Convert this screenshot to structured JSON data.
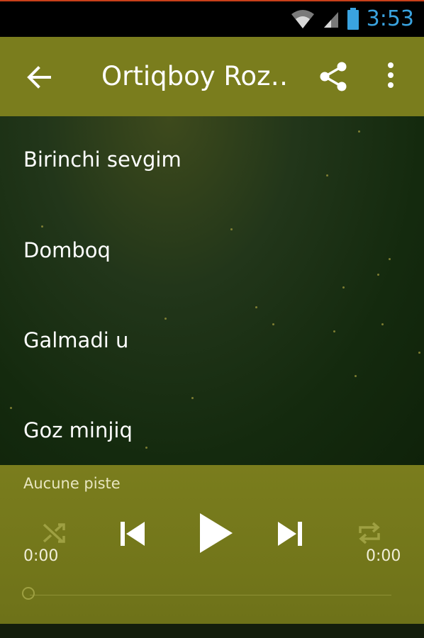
{
  "status_bar": {
    "time": "3:53",
    "icons": [
      "wifi-icon",
      "signal-icon",
      "battery-icon"
    ]
  },
  "app_bar": {
    "title": "Ortiqboy Roz…",
    "back_icon": "arrow-back-icon",
    "share_icon": "share-icon",
    "more_icon": "more-vert-icon"
  },
  "tracks": [
    {
      "label": "Birinchi sevgim"
    },
    {
      "label": "Domboq"
    },
    {
      "label": "Galmadi u"
    },
    {
      "label": "Goz minjiq"
    }
  ],
  "player": {
    "now_playing": "Aucune piste",
    "elapsed": "0:00",
    "duration": "0:00",
    "progress": 0,
    "controls": [
      "shuffle-icon",
      "skip-previous-icon",
      "play-icon",
      "skip-next-icon",
      "repeat-icon"
    ]
  },
  "colors": {
    "accent": "#7a7d1d",
    "clock": "#3aa3e0",
    "background": "#142a0e"
  }
}
